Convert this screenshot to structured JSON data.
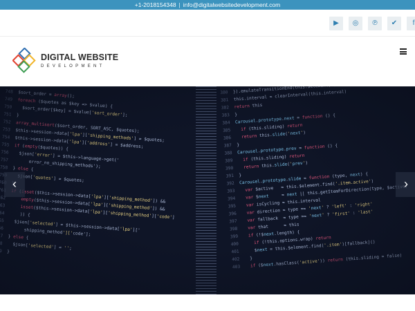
{
  "topbar": {
    "phone": "+1-2018154348",
    "separator": "|",
    "email": "info@digitalwebsitedevelopment.com"
  },
  "social": [
    {
      "name": "youtube",
      "glyph": "▶"
    },
    {
      "name": "instagram",
      "glyph": "◎"
    },
    {
      "name": "pinterest",
      "glyph": "℗"
    },
    {
      "name": "twitter",
      "glyph": "✔"
    },
    {
      "name": "facebook",
      "glyph": "f"
    }
  ],
  "brand": {
    "line1": "DIGITAL WEBSITE",
    "line2": "DEVELOPMENT",
    "logo_colors": [
      "#2f6fb2",
      "#e2412f",
      "#f1b52a",
      "#3f9e54"
    ]
  },
  "slider": {
    "prev_glyph": "‹",
    "next_glyph": "›"
  },
  "code_left": [
    "$sort_order = array();",
    "foreach ($quotes as $key => $value) {",
    "  $sort_order[$key] = $value['sort_order'];",
    "}",
    "array_multisort($sort_order, SORT_ASC, $quotes);",
    "$this->session->data['lpa']['shipping_methods'] = $quotes;",
    "$this->session->data['lpa']['address'] = $address;",
    "if (empty($quotes)) {",
    "  $json['error'] = $this->language->get('",
    "      error_no_shipping_methods');",
    "} else {",
    "  $json['quotes'] = $quotes;",
    "}",
    "if (isset($this->session->data['lpa']['shipping_method']) &&",
    "    empty($this->session->data['lpa']['shipping_method']) &&",
    "    isset($this->session->data['lpa']['shipping_method']['code']",
    "    )) {",
    "  $json['selected'] = $this->session->data['lpa']['",
    "      shipping_method']['code'];",
    "} else {",
    "  $json['selected'] = '';",
    "}"
  ],
  "code_right": [
    "}).emulateTransitionEnd(this.$element, $.support.transition)",
    "this.interval = clearInterval(this.interval)",
    "return this",
    "}",
    "Carousel.prototype.next = function () {",
    "  if (this.sliding) return",
    "  return this.slide('next')",
    "}",
    "Carousel.prototype.prev = function () {",
    "  if (this.sliding) return",
    "  return this.slide('prev')",
    "}",
    "Carousel.prototype.slide = function (type, next) {",
    "  var $active   = this.$element.find('.item.active')",
    "  var $next     = next || this.getItemForDirection(type, $active)",
    "  var isCycling = this.interval",
    "  var direction = type == 'next' ? 'left' : 'right'",
    "  var fallback  = type == 'next' ? 'first' : 'last'",
    "  var that      = this",
    "  if (!$next.length) {",
    "    if (!this.options.wrap) return",
    "    $next = this.$element.find('.item')[fallback]()",
    "  }",
    "  if ($next.hasClass('active')) return (this.sliding = false)"
  ]
}
